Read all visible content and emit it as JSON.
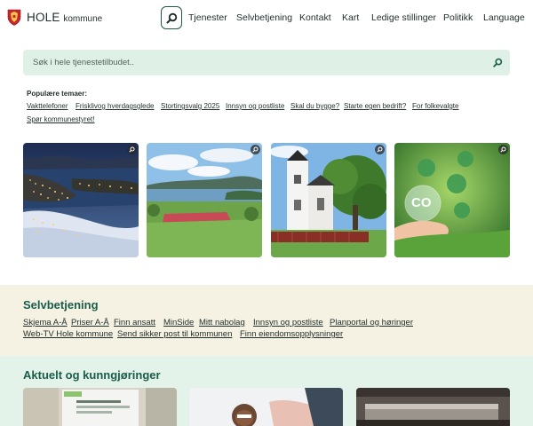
{
  "header": {
    "brand_main": "HOLE",
    "brand_sub": "kommune",
    "nav": [
      {
        "label": "Tjenester"
      },
      {
        "label": "Selvbetjening"
      },
      {
        "label": "Kontakt"
      },
      {
        "label": "Kart"
      },
      {
        "label": "Ledige stillinger"
      },
      {
        "label": "Politikk"
      },
      {
        "label": "Language"
      }
    ]
  },
  "search": {
    "placeholder": "Søk i hele tjenestetilbudet.."
  },
  "popular": {
    "title": "Populære temaer:",
    "links": [
      "Vakttelefoner",
      "Frisklivog hverdagsglede",
      "Stortingsvalg 2025",
      "Innsyn og postliste",
      "Skal du bygge?",
      "Starte egen bedrift?",
      "For folkevalgte",
      "Spør kommunestyret!"
    ]
  },
  "tiles": [
    {
      "icon": "zoom-icon"
    },
    {
      "icon": "zoom-icon"
    },
    {
      "icon": "zoom-icon"
    },
    {
      "icon": "zoom-icon",
      "overlay_text": "CO"
    }
  ],
  "selvbetjening": {
    "title": "Selvbetjening",
    "links": [
      "Skjema A-Å",
      "Priser A-Å",
      "Finn ansatt",
      "MinSide",
      "Mitt nabolag",
      "Innsyn og postliste",
      "Planportal og høringer",
      "Web-TV Hole kommune",
      "Send sikker post til kommunen",
      "Finn eiendomsopplysninger"
    ]
  },
  "aktuelt": {
    "title": "Aktuelt og kunngjøringer"
  },
  "colors": {
    "brand_green": "#1a5c4a",
    "search_bg": "#dff0e6",
    "band_cream": "#f5f2e3",
    "band_mint": "#e3f3ea"
  }
}
